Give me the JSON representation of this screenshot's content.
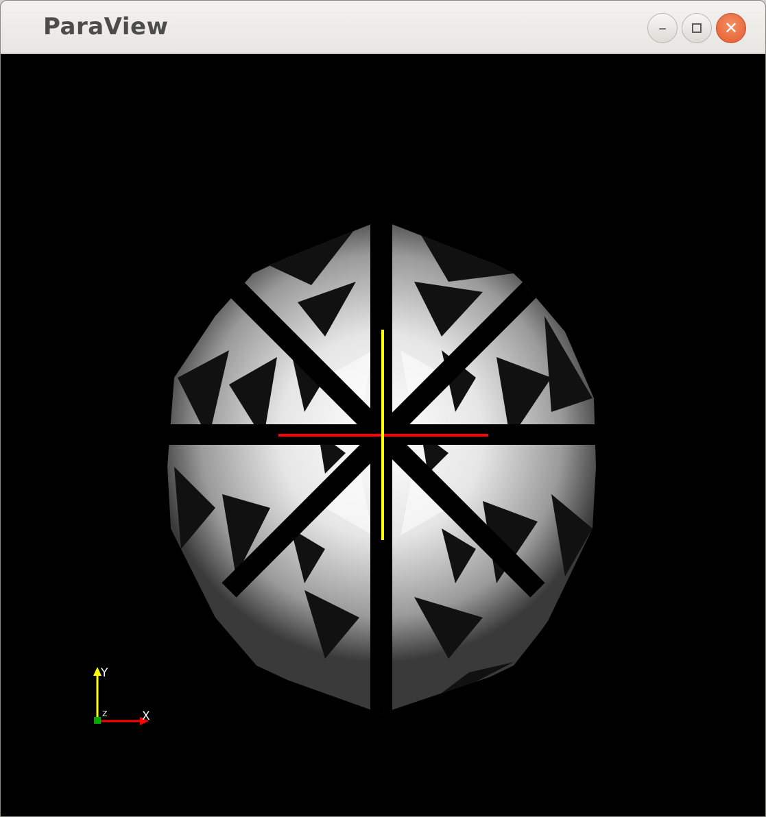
{
  "window": {
    "title": "ParaView",
    "controls": {
      "minimize_icon": "minimize-icon",
      "maximize_icon": "maximize-icon",
      "close_icon": "close-icon"
    }
  },
  "render_view": {
    "background_color": "#000000",
    "center_axes": {
      "x_axis_color": "#ff0000",
      "y_axis_color": "#ffff00"
    },
    "orientation_axes": {
      "x_label": "X",
      "y_label": "Y",
      "z_label": "Z",
      "x_color": "#ff0000",
      "y_color": "#ffff00",
      "z_color": "#00aa00"
    }
  }
}
